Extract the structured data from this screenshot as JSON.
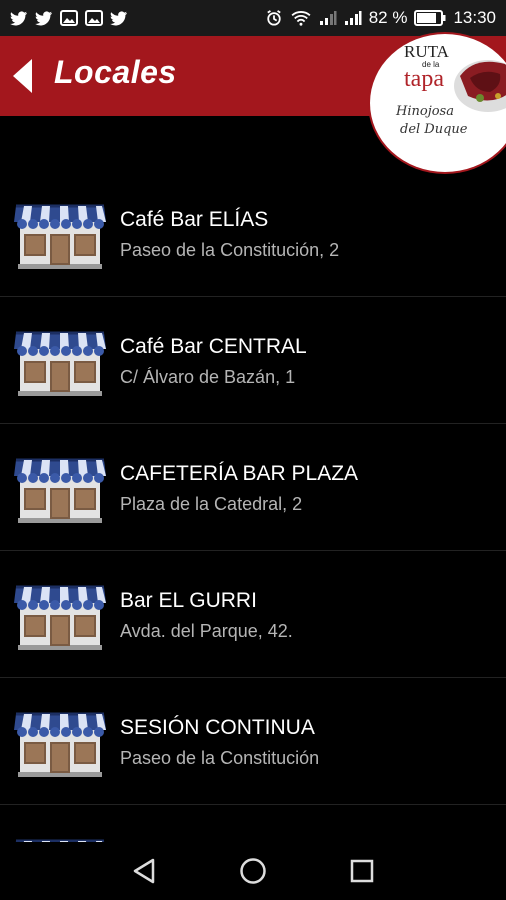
{
  "status_bar": {
    "battery": "82 %",
    "time": "13:30",
    "notification_icons": [
      "twitter-icon",
      "twitter-icon",
      "image-icon",
      "image-icon",
      "twitter-icon"
    ],
    "system_icons": [
      "alarm-icon",
      "wifi-icon",
      "signal-icon",
      "signal-icon",
      "battery-icon"
    ]
  },
  "app_bar": {
    "title": "Locales",
    "back_icon": "back-arrow-icon",
    "color": "#a3171d"
  },
  "logo": {
    "ruta": "RUTA",
    "de_la": "de la",
    "tapa": "tapa",
    "hinojosa": "Hinojosa",
    "del_duque": "del Duque"
  },
  "venues": [
    {
      "name": "Café Bar ELÍAS",
      "address": "Paseo de la Constitución, 2"
    },
    {
      "name": "Café Bar CENTRAL",
      "address": "C/ Álvaro de Bazán, 1"
    },
    {
      "name": "CAFETERÍA BAR PLAZA",
      "address": "Plaza de la Catedral, 2"
    },
    {
      "name": "Bar EL GURRI",
      "address": "Avda. del Parque, 42."
    },
    {
      "name": "SESIÓN CONTINUA",
      "address": "Paseo de la Constitución"
    },
    {
      "name": "",
      "address": ""
    }
  ],
  "nav_bar": {
    "icons": [
      "back-nav-icon",
      "home-nav-icon",
      "recents-nav-icon"
    ]
  }
}
